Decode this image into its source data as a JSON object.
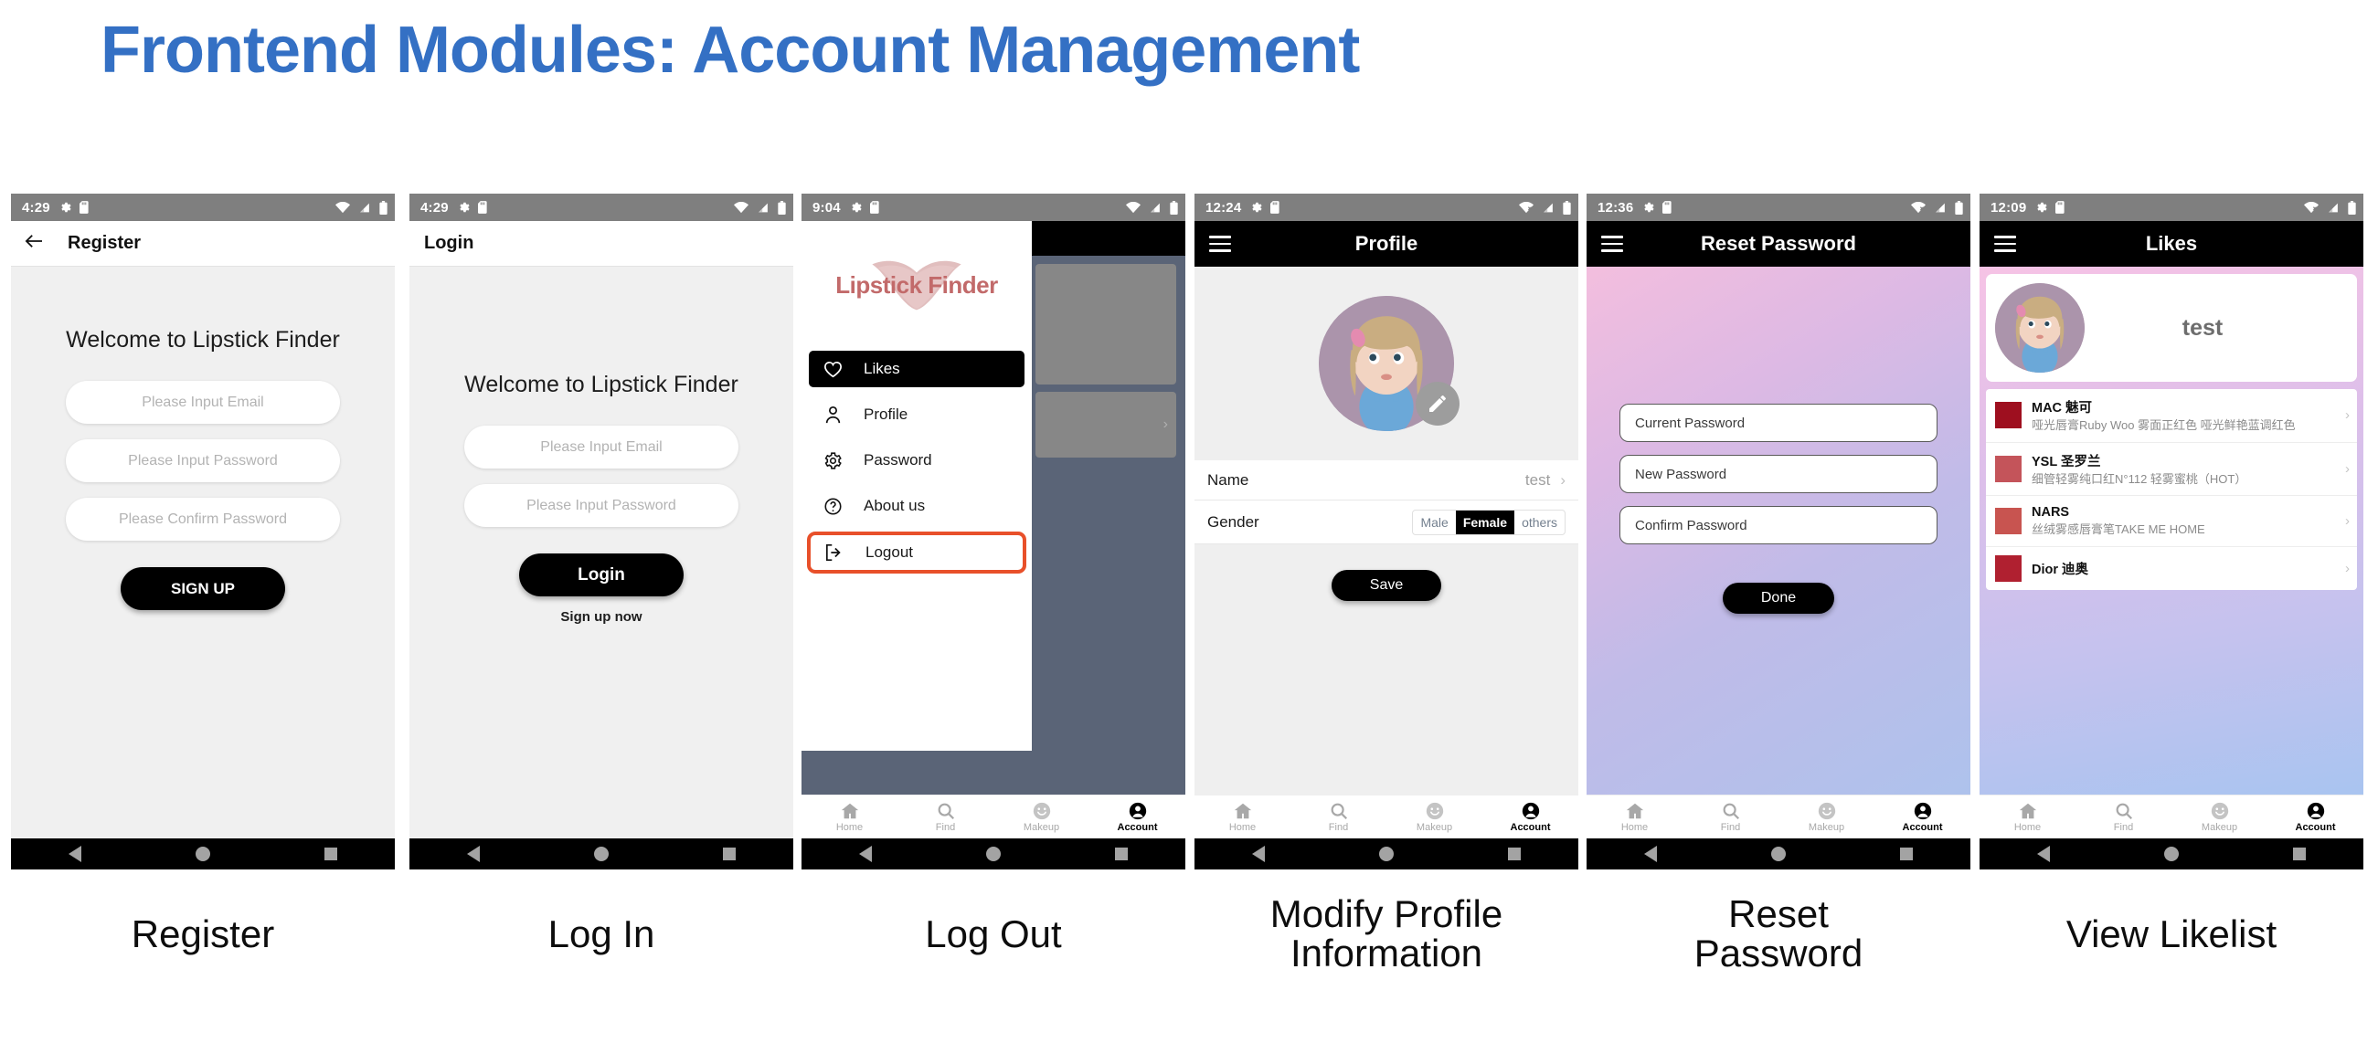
{
  "slide": {
    "title": "Frontend Modules: Account Management",
    "title_color": "#3470c4"
  },
  "common": {
    "bottom_nav": [
      {
        "label": "Home",
        "icon": "home-icon"
      },
      {
        "label": "Find",
        "icon": "search-icon"
      },
      {
        "label": "Makeup",
        "icon": "smiley-icon"
      },
      {
        "label": "Account",
        "icon": "person-circle-icon"
      }
    ],
    "bottom_nav_active": "Account",
    "android_nav": [
      "back-triangle-icon",
      "home-circle-icon",
      "recents-square-icon"
    ],
    "status_icons": [
      "gear-icon",
      "sd-card-icon",
      "wifi-icon",
      "signal-icon",
      "battery-icon"
    ]
  },
  "screens": [
    {
      "id": "register",
      "caption": "Register",
      "status_time": "4:29",
      "appbar": {
        "style": "light",
        "title": "Register",
        "back_icon": "arrow-left-icon"
      },
      "welcome": "Welcome to Lipstick Finder",
      "inputs": [
        {
          "placeholder": "Please Input Email",
          "value": ""
        },
        {
          "placeholder": "Please Input Password",
          "value": ""
        },
        {
          "placeholder": "Please Confirm Password",
          "value": ""
        }
      ],
      "primary_button": "SIGN UP"
    },
    {
      "id": "login",
      "caption": "Log In",
      "status_time": "4:29",
      "appbar": {
        "style": "light",
        "title": "Login"
      },
      "welcome": "Welcome to Lipstick Finder",
      "inputs": [
        {
          "placeholder": "Please Input Email",
          "value": ""
        },
        {
          "placeholder": "Please Input Password",
          "value": ""
        }
      ],
      "primary_button": "Login",
      "secondary_link": "Sign up now"
    },
    {
      "id": "logout",
      "caption": "Log Out",
      "status_time": "9:04",
      "logo_text": "Lipstick Finder",
      "drawer_items": [
        {
          "label": "Likes",
          "icon": "heart-icon",
          "state": "active"
        },
        {
          "label": "Profile",
          "icon": "person-icon",
          "state": "normal"
        },
        {
          "label": "Password",
          "icon": "gear-icon",
          "state": "normal"
        },
        {
          "label": "About us",
          "icon": "question-circle-icon",
          "state": "normal"
        },
        {
          "label": "Logout",
          "icon": "logout-icon",
          "state": "highlighted"
        }
      ],
      "highlight_color": "#e8502a"
    },
    {
      "id": "profile",
      "caption": "Modify Profile Information",
      "status_time": "12:24",
      "appbar": {
        "style": "dark",
        "title": "Profile",
        "menu_icon": "hamburger-icon"
      },
      "avatar_edit_icon": "pencil-icon",
      "rows": [
        {
          "label": "Name",
          "value": "test",
          "chevron": "›"
        }
      ],
      "gender": {
        "label": "Gender",
        "options": [
          "Male",
          "Female",
          "others"
        ],
        "selected": "Female"
      },
      "primary_button": "Save"
    },
    {
      "id": "reset-password",
      "caption": "Reset Password",
      "status_time": "12:36",
      "appbar": {
        "style": "dark",
        "title": "Reset Password",
        "menu_icon": "hamburger-icon"
      },
      "inputs": [
        {
          "placeholder": "Current Password",
          "value": "Current Password"
        },
        {
          "placeholder": "New Password",
          "value": "New Password"
        },
        {
          "placeholder": "Confirm Password",
          "value": "Confirm Password"
        }
      ],
      "primary_button": "Done"
    },
    {
      "id": "likes",
      "caption": "View Likelist",
      "status_time": "12:09",
      "appbar": {
        "style": "dark",
        "title": "Likes",
        "menu_icon": "hamburger-icon"
      },
      "user_name": "test",
      "items": [
        {
          "brand": "MAC 魅可",
          "desc": "哑光唇膏Ruby Woo 雾面正红色 哑光鲜艳蓝调红色",
          "color": "#9e0f1f"
        },
        {
          "brand": "YSL 圣罗兰",
          "desc": "细管轻雾纯口红N°112 轻雾蜜桃（HOT）",
          "color": "#c4545a"
        },
        {
          "brand": "NARS",
          "desc": "丝绒雾感唇膏笔TAKE ME HOME",
          "color": "#c85450"
        },
        {
          "brand": "Dior 迪奥",
          "desc": "",
          "color": "#b02030"
        }
      ]
    }
  ]
}
